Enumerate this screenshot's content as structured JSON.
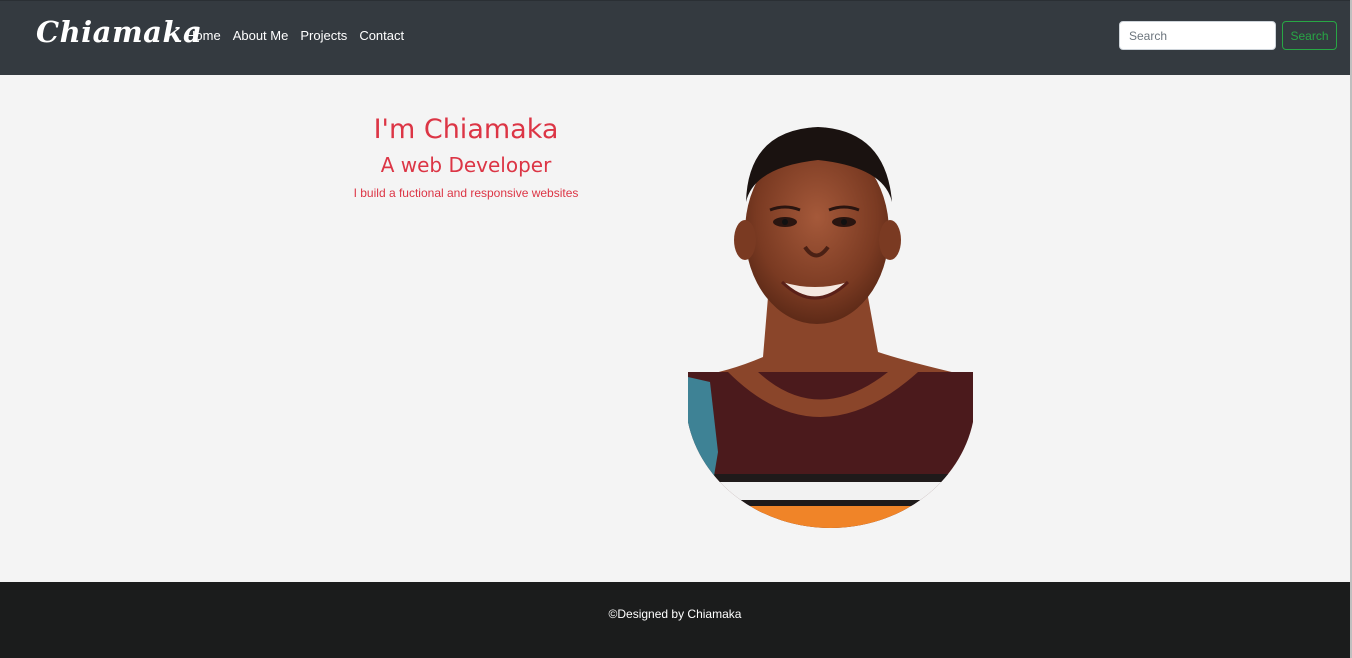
{
  "navbar": {
    "brand": "Chiamaka",
    "links": [
      "Home",
      "About Me",
      "Projects",
      "Contact"
    ],
    "search": {
      "placeholder": "Search",
      "value": "",
      "button_label": "Search"
    }
  },
  "hero": {
    "title": "I'm Chiamaka",
    "subtitle": "A web Developer",
    "description": "I build a fuctional and responsive websites"
  },
  "footer": {
    "text": "©Designed by Chiamaka"
  },
  "colors": {
    "navbar_bg": "#343a40",
    "accent_red": "#dc3545",
    "search_green": "#28a745",
    "footer_bg": "#1b1c1c",
    "page_bg": "#f4f4f4"
  }
}
